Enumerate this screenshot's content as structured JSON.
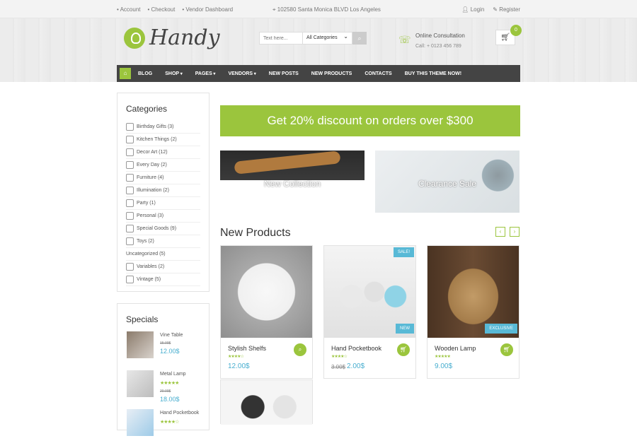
{
  "topbar": {
    "left_links": [
      "Account",
      "Checkout",
      "Vendor Dashboard"
    ],
    "address": "102580 Santa Monica BLVD Los Angeles",
    "login": "Login",
    "register": "Register",
    "icons": {
      "pin": "map-pin-icon",
      "user": "user-icon",
      "pencil": "pencil-icon"
    }
  },
  "header": {
    "logo_text": "Handy",
    "search_placeholder": "Text here...",
    "category_select": "All Categories",
    "consult_title": "Online Consultation",
    "consult_phone": "Call: + 0123 456 789",
    "cart_count": "0"
  },
  "nav": [
    "BLOG",
    "SHOP",
    "PAGES",
    "VENDORS",
    "NEW POSTS",
    "NEW PRODUCTS",
    "CONTACTS",
    "BUY THIS THEME NOW!"
  ],
  "categories": {
    "title": "Categories",
    "items": [
      "Birthday Gifts (3)",
      "Kitchen Things (2)",
      "Decor Art (12)",
      "Every Day (2)",
      "Furniture (4)",
      "Illumination (2)",
      "Party (1)",
      "Personal (3)",
      "Special Goods (9)",
      "Toys (2)",
      "Uncategorized (5)",
      "Variables (2)",
      "Vintage (5)"
    ]
  },
  "specials": {
    "title": "Specials",
    "items": [
      {
        "name": "Vine Table",
        "old_price": "15.00$",
        "price": "12.00$"
      },
      {
        "name": "Metal Lamp",
        "old_price": "20.00$",
        "price": "18.00$"
      },
      {
        "name": "Hand Pocketbook",
        "old_price": "",
        "price": ""
      }
    ]
  },
  "banner": "Get 20% discount on orders over $300",
  "promos": [
    "New Collection",
    "Clearance Sale"
  ],
  "new_products": {
    "title": "New Products",
    "items": [
      {
        "name": "Stylish Shelfs",
        "price": "12.00$",
        "old_price": "",
        "tags": []
      },
      {
        "name": "Hand Pocketbook",
        "price": "2.00$",
        "old_price": "3.00$",
        "tags": [
          "SALE!",
          "NEW"
        ]
      },
      {
        "name": "Wooden Lamp",
        "price": "9.00$",
        "old_price": "",
        "tags": [
          "EXCLUSIVE"
        ]
      }
    ]
  },
  "colors": {
    "accent": "#9bc53d",
    "price": "#48aecf",
    "nav_bg": "#444444",
    "tag": "#58b9d6"
  }
}
